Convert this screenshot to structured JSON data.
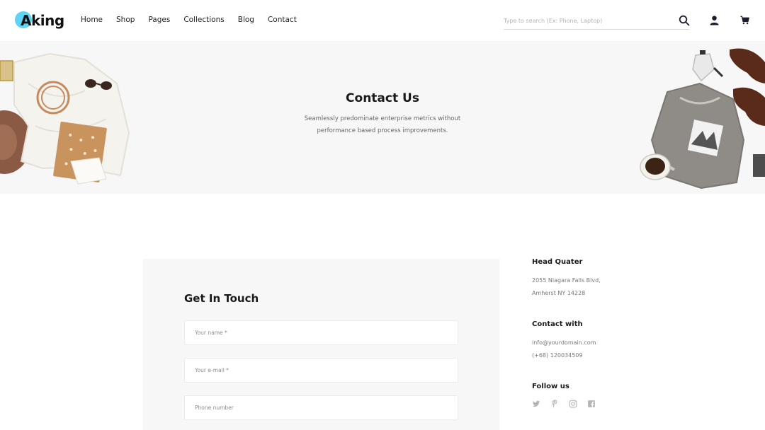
{
  "brand": {
    "logo_text": "Aking",
    "accent": "#5dd3f5"
  },
  "nav": {
    "items": [
      {
        "label": "Home"
      },
      {
        "label": "Shop"
      },
      {
        "label": "Pages"
      },
      {
        "label": "Collections"
      },
      {
        "label": "Blog"
      },
      {
        "label": "Contact"
      }
    ]
  },
  "search": {
    "placeholder": "Type to search (Ex: Phone, Laptop)",
    "icon": "search-icon"
  },
  "header_icons": {
    "user": "user-icon",
    "cart": "cart-icon"
  },
  "hero": {
    "title": "Contact Us",
    "subtitle": "Seamlessly predominate enterprise metrics without performance based process improvements.",
    "background": "#f7f7f7"
  },
  "form": {
    "title": "Get In Touch",
    "name_placeholder": "Your name *",
    "email_placeholder": "Your e-mail *",
    "phone_placeholder": "Phone number"
  },
  "info": {
    "head_quarter": {
      "heading": "Head Quater",
      "address_line1": "2055 Niagara Falls Blvd,",
      "address_line2": "Amherst NY 14228"
    },
    "contact": {
      "heading": "Contact with",
      "email": "info@yourdomain.com",
      "phone": "(+68) 120034509"
    },
    "follow": {
      "heading": "Follow us",
      "icons": [
        "twitter-icon",
        "pinterest-icon",
        "instagram-icon",
        "facebook-icon"
      ]
    }
  }
}
